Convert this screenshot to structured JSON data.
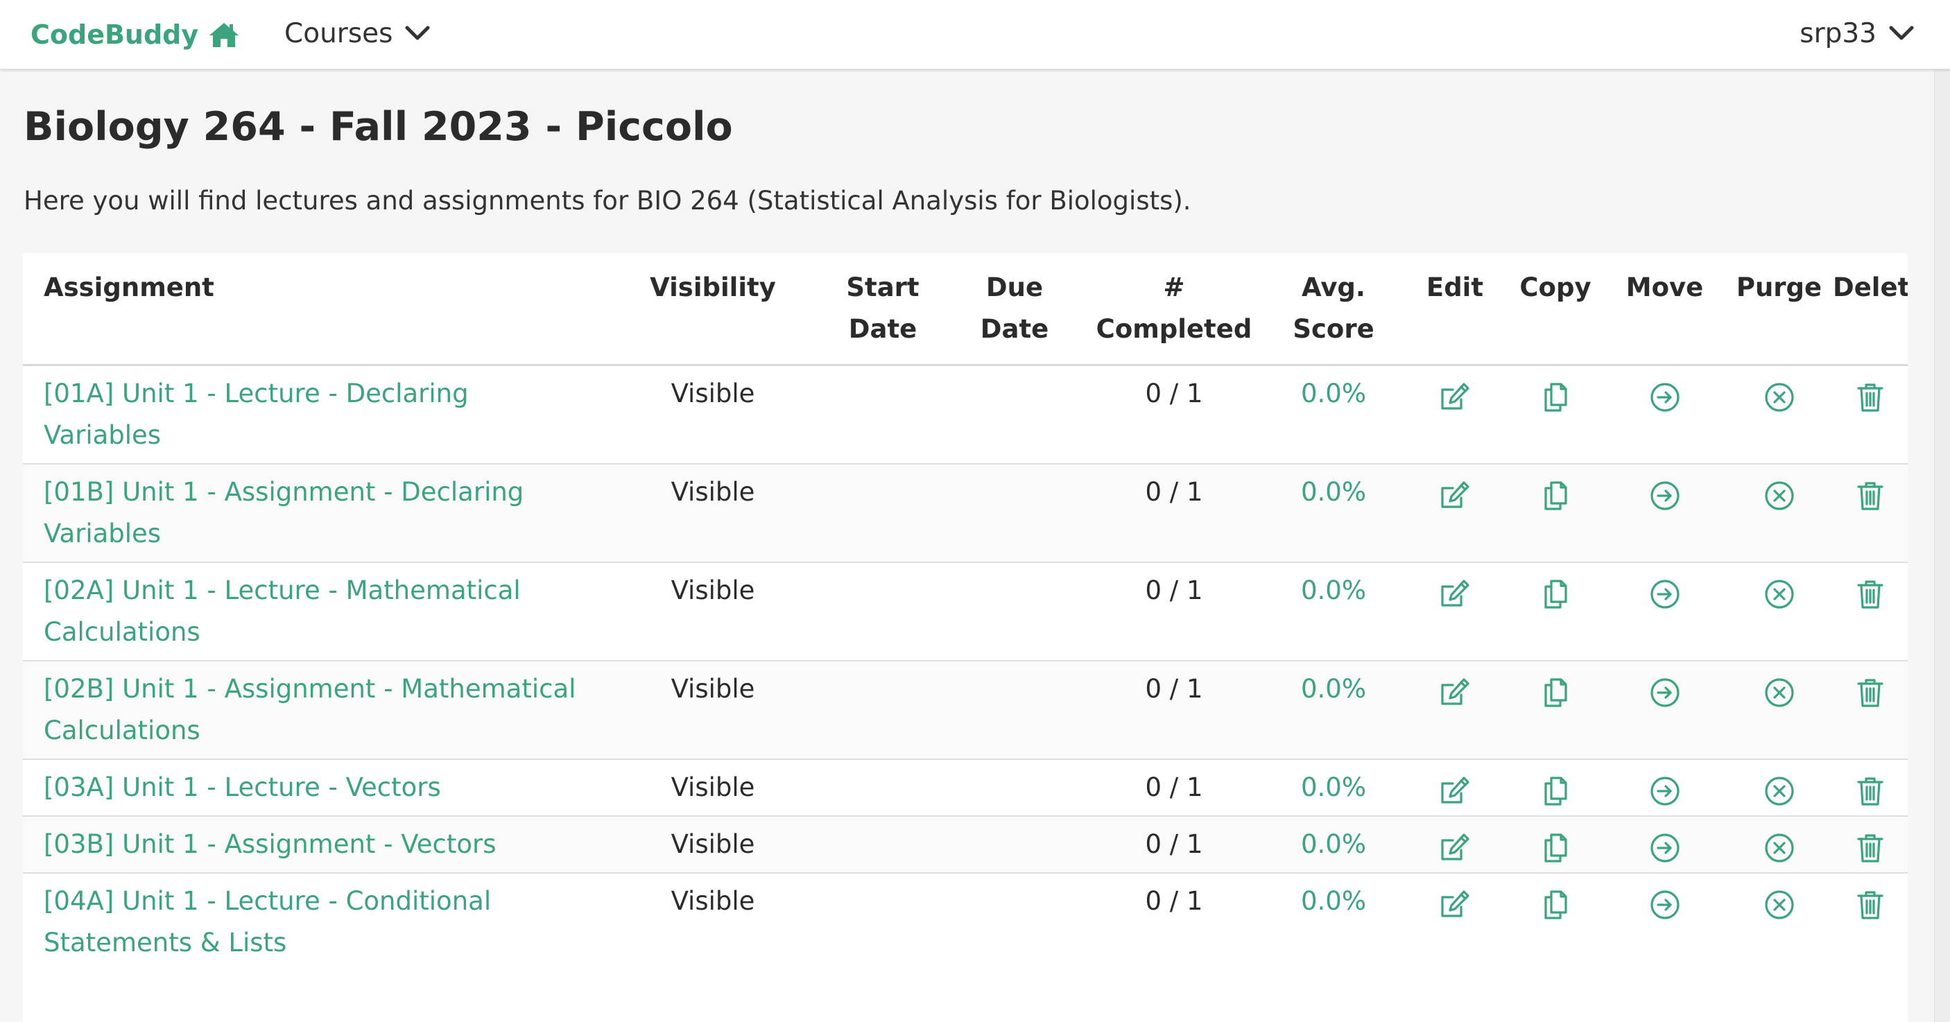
{
  "navbar": {
    "brand": "CodeBuddy",
    "brand_icon": "home-icon",
    "courses_label": "Courses",
    "user_label": "srp33",
    "accent_color": "#3aa47c"
  },
  "page": {
    "title": "Biology 264 - Fall 2023 - Piccolo",
    "description": "Here you will find lectures and assignments for BIO 264 (Statistical Analysis for Biologists)."
  },
  "table": {
    "headers": {
      "assignment": "Assignment",
      "visibility": "Visibility",
      "start_1": "Start",
      "start_2": "Date",
      "due_1": "Due",
      "due_2": "Date",
      "completed_1": "#",
      "completed_2": "Completed",
      "score_1": "Avg.",
      "score_2": "Score",
      "edit": "Edit",
      "copy": "Copy",
      "move": "Move",
      "purge": "Purge",
      "delete": "Delete"
    },
    "rows": [
      {
        "title": "[01A] Unit 1 - Lecture - Declaring Variables",
        "visibility": "Visible",
        "start": "",
        "due": "",
        "completed": "0 / 1",
        "score": "0.0%"
      },
      {
        "title": "[01B] Unit 1 - Assignment - Declaring Variables",
        "visibility": "Visible",
        "start": "",
        "due": "",
        "completed": "0 / 1",
        "score": "0.0%"
      },
      {
        "title": "[02A] Unit 1 - Lecture - Mathematical Calculations",
        "visibility": "Visible",
        "start": "",
        "due": "",
        "completed": "0 / 1",
        "score": "0.0%"
      },
      {
        "title": "[02B] Unit 1 - Assignment - Mathematical Calculations",
        "visibility": "Visible",
        "start": "",
        "due": "",
        "completed": "0 / 1",
        "score": "0.0%"
      },
      {
        "title": "[03A] Unit 1 - Lecture - Vectors",
        "visibility": "Visible",
        "start": "",
        "due": "",
        "completed": "0 / 1",
        "score": "0.0%"
      },
      {
        "title": "[03B] Unit 1 - Assignment - Vectors",
        "visibility": "Visible",
        "start": "",
        "due": "",
        "completed": "0 / 1",
        "score": "0.0%"
      },
      {
        "title": "[04A] Unit 1 - Lecture - Conditional Statements & Lists",
        "visibility": "Visible",
        "start": "",
        "due": "",
        "completed": "0 / 1",
        "score": "0.0%"
      }
    ],
    "action_icons": [
      "edit-icon",
      "copy-icon",
      "move-icon",
      "purge-icon",
      "delete-icon"
    ]
  }
}
